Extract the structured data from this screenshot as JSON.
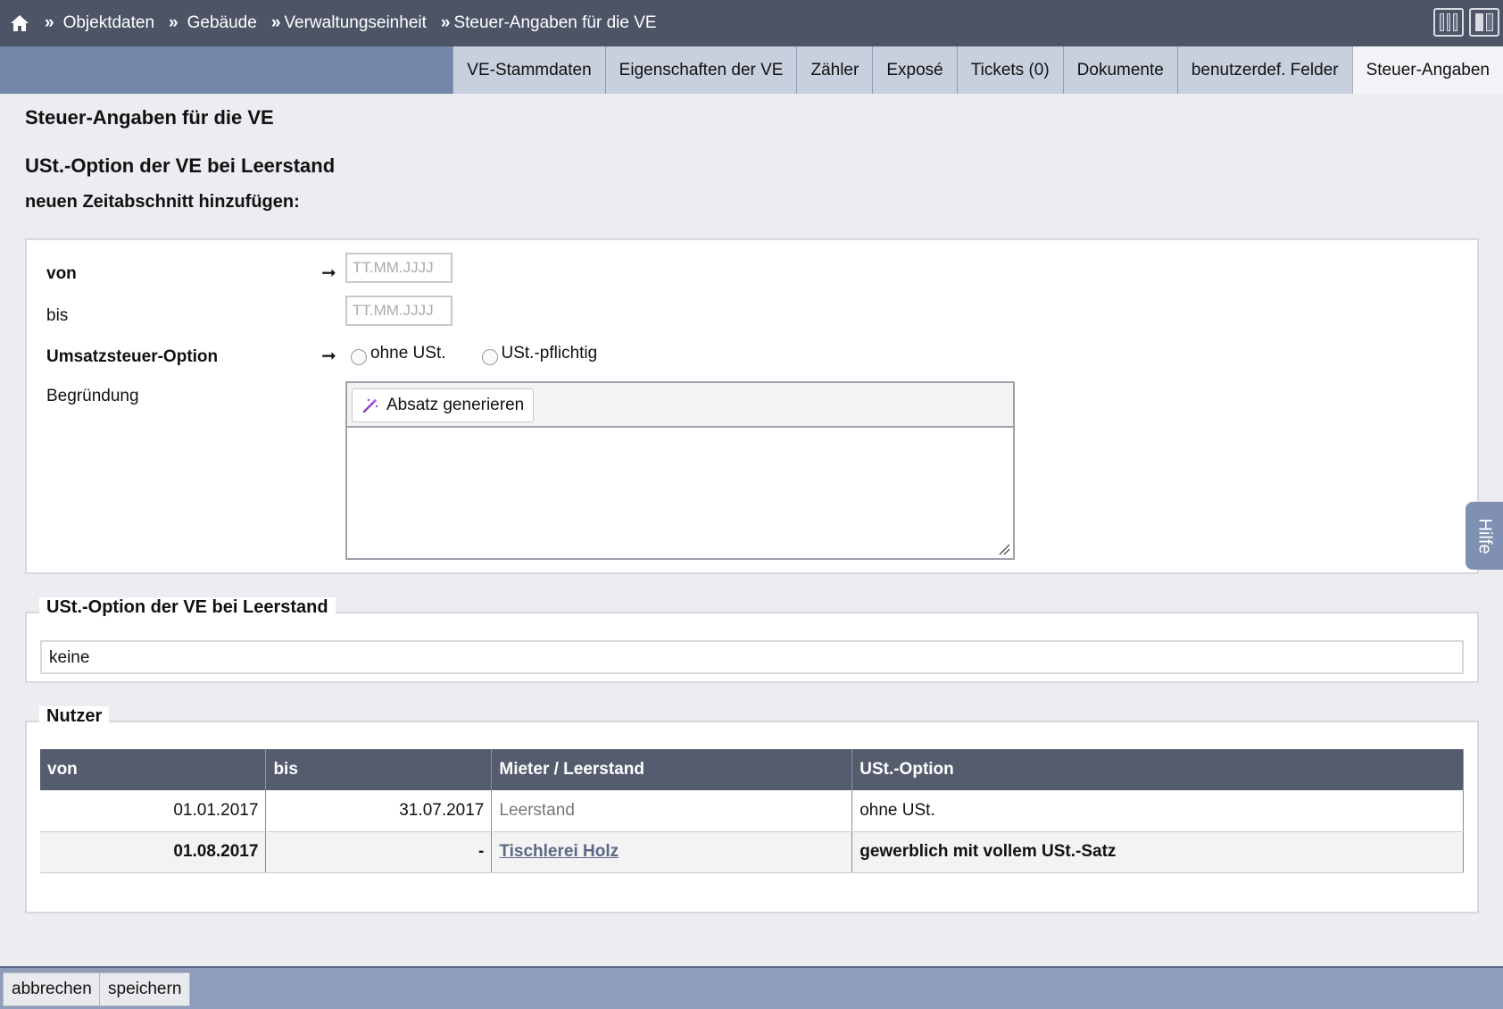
{
  "breadcrumb": {
    "items": [
      {
        "label": "Objektdaten"
      },
      {
        "label": "Gebäude"
      },
      {
        "label": "Verwaltungseinheit"
      },
      {
        "label": "Steuer-Angaben für die VE"
      }
    ],
    "separator": "»"
  },
  "tabs": [
    {
      "label": "VE-Stammdaten",
      "active": false
    },
    {
      "label": "Eigenschaften der VE",
      "active": false
    },
    {
      "label": "Zähler",
      "active": false
    },
    {
      "label": "Exposé",
      "active": false
    },
    {
      "label": "Tickets (0)",
      "active": false
    },
    {
      "label": "Dokumente",
      "active": false
    },
    {
      "label": "benutzerdef. Felder",
      "active": false
    },
    {
      "label": "Steuer-Angaben",
      "active": true
    }
  ],
  "page": {
    "title": "Steuer-Angaben für die VE",
    "section_title": "USt.-Option der VE bei Leerstand",
    "subsection_title": "neuen Zeitabschnitt hinzufügen:"
  },
  "form": {
    "von_label": "von",
    "von_placeholder": "TT.MM.JJJJ",
    "bis_label": "bis",
    "bis_placeholder": "TT.MM.JJJJ",
    "option_label": "Umsatzsteuer-Option",
    "option_a": "ohne USt.",
    "option_b": "USt.-pflichtig",
    "begruendung_label": "Begründung",
    "generate_button": "Absatz generieren",
    "required_arrow": "➞"
  },
  "ust_panel": {
    "legend": "USt.-Option der VE bei Leerstand",
    "value": "keine"
  },
  "nutzer": {
    "legend": "Nutzer",
    "columns": [
      "von",
      "bis",
      "Mieter / Leerstand",
      "USt.-Option"
    ],
    "rows": [
      {
        "von": "01.01.2017",
        "bis": "31.07.2017",
        "mieter": "Leerstand",
        "ust": "ohne USt."
      },
      {
        "von": "01.08.2017",
        "bis": "-",
        "mieter": "Tischlerei Holz",
        "ust": "gewerblich mit vollem USt.-Satz"
      }
    ]
  },
  "help": {
    "label": "Hilfe"
  },
  "footer": {
    "cancel": "abbrechen",
    "save": "speichern"
  },
  "icons": {
    "home": "home-icon",
    "layout_narrow": "columns-narrow-icon",
    "layout_wide": "columns-wide-icon",
    "wand": "magic-wand-icon",
    "resize": "resize-handle-icon"
  },
  "colors": {
    "topbar": "#4c5466",
    "tabbar": "#7486a9",
    "footer": "#8f9dbb",
    "table_header": "#545c6e",
    "link": "#5b6986",
    "help": "#7f90b3"
  }
}
